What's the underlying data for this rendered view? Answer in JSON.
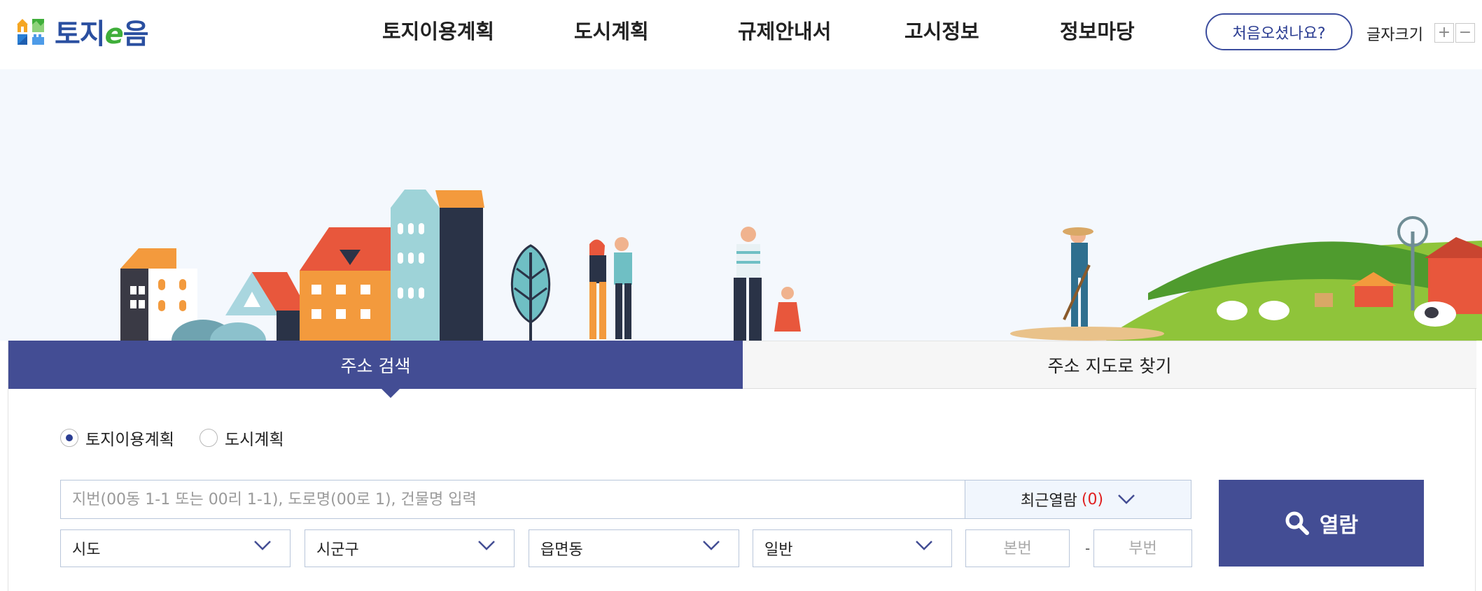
{
  "header": {
    "logo_text_a": "토지",
    "logo_text_e": "e",
    "logo_text_b": "음",
    "nav": [
      {
        "label": "토지이용계획"
      },
      {
        "label": "도시계획"
      },
      {
        "label": "규제안내서"
      },
      {
        "label": "고시정보"
      },
      {
        "label": "정보마당"
      }
    ],
    "first_visit_label": "처음오셨나요?",
    "font_size_label": "글자크기",
    "font_plus": "+",
    "font_minus": "−"
  },
  "search": {
    "tabs": [
      {
        "label": "주소 검색",
        "active": true
      },
      {
        "label": "주소 지도로 찾기",
        "active": false
      }
    ],
    "radios": [
      {
        "label": "토지이용계획",
        "checked": true
      },
      {
        "label": "도시계획",
        "checked": false
      }
    ],
    "address_placeholder": "지번(00동 1-1 또는 00리 1-1), 도로명(00로 1), 건물명 입력",
    "recent_label": "최근열람",
    "recent_count": "(0)",
    "selects": [
      {
        "label": "시도"
      },
      {
        "label": "시군구"
      },
      {
        "label": "읍면동"
      },
      {
        "label": "일반"
      }
    ],
    "main_number_placeholder": "본번",
    "dash": "-",
    "sub_number_placeholder": "부번",
    "open_button_label": "열람"
  },
  "colors": {
    "primary": "#434d94",
    "accent_red": "#e02020",
    "hero_bg": "#f4f8fd"
  }
}
